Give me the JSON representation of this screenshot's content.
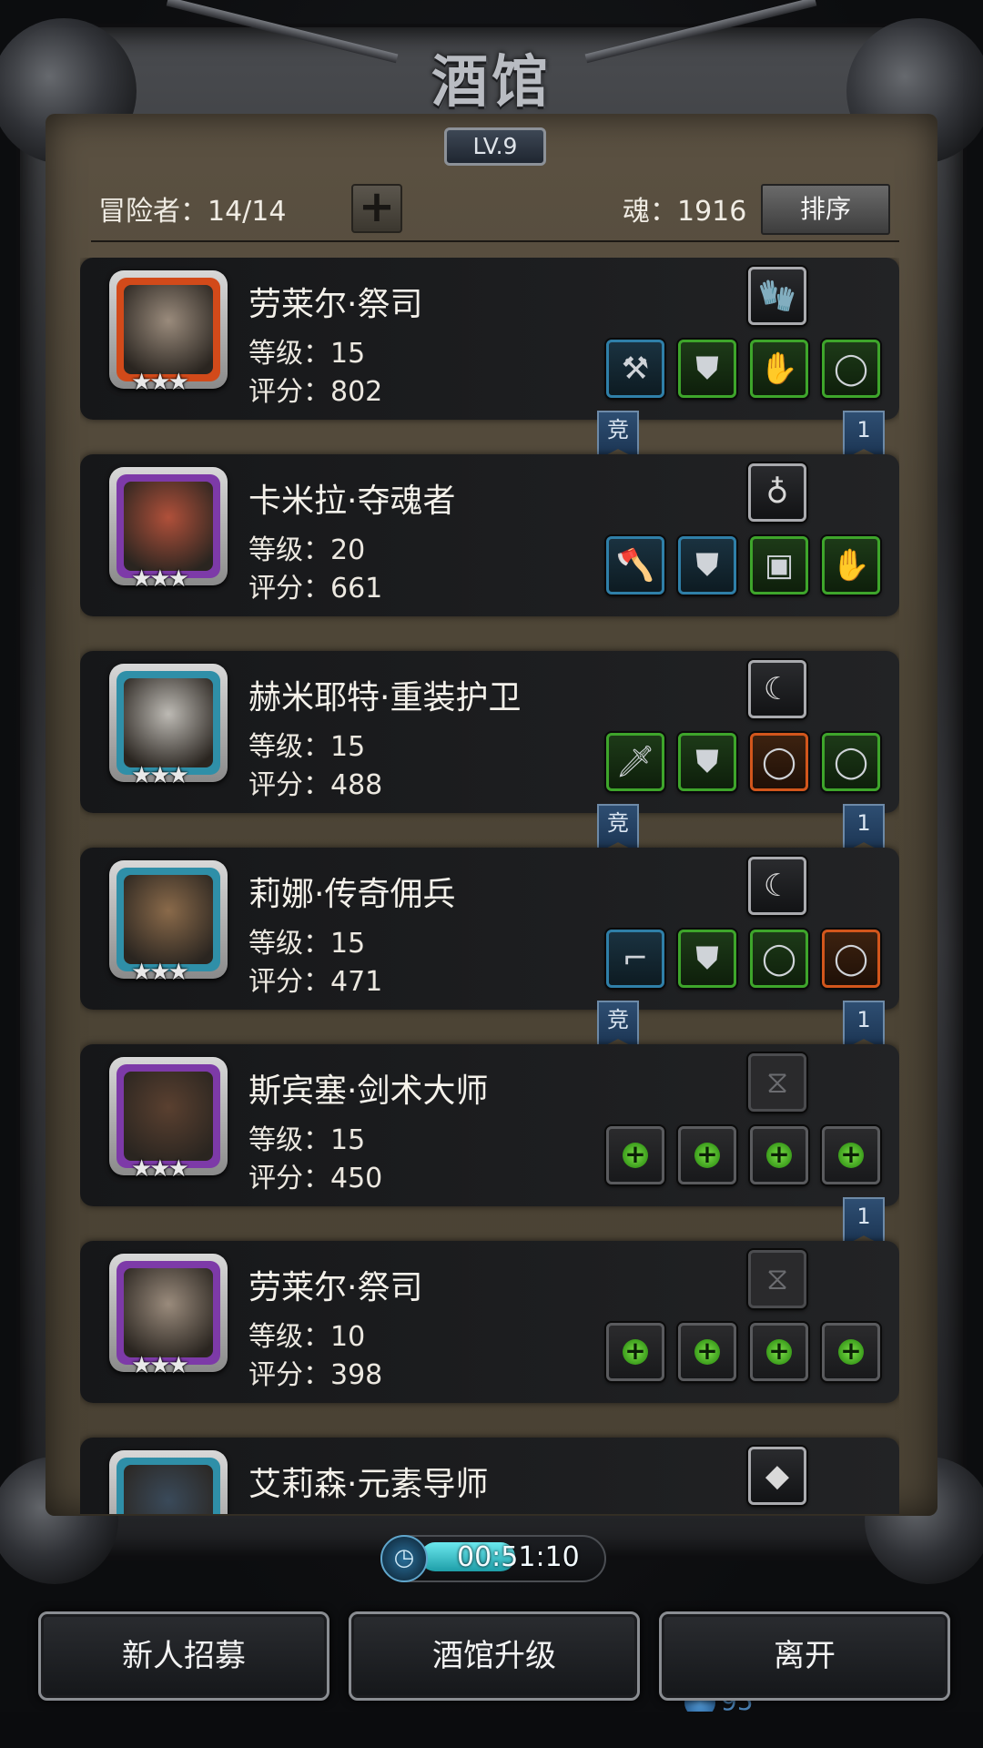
{
  "title": "酒馆",
  "level_badge": "LV.9",
  "header": {
    "adventurers": "冒险者：14/14",
    "soul": "魂：1916",
    "sort_label": "排序"
  },
  "heroes": [
    {
      "name": "劳莱尔·祭司",
      "level": "等级：15",
      "score": "评分：802",
      "stars": "★★★",
      "frame_color": "#d24a1a",
      "face_color": "#9a8b7c",
      "top_item": {
        "icon": "glove-icon",
        "rarity": "gray",
        "glyph": "🧤"
      },
      "items": [
        {
          "icon": "hammer-icon",
          "rarity": "blue",
          "glyph": "⚒"
        },
        {
          "icon": "chest-armor-icon",
          "rarity": "green",
          "glyph": "⛊"
        },
        {
          "icon": "gauntlet-icon",
          "rarity": "green",
          "glyph": "✋"
        },
        {
          "icon": "ring-icon",
          "rarity": "green",
          "glyph": "◯"
        }
      ],
      "badges": {
        "left": "竞",
        "right": "1"
      }
    },
    {
      "name": "卡米拉·夺魂者",
      "level": "等级：20",
      "score": "评分：661",
      "stars": "★★★",
      "frame_color": "#7d3aa8",
      "face_color": "#b0503a",
      "top_item": {
        "icon": "amulet-icon",
        "rarity": "gray",
        "glyph": "♁"
      },
      "items": [
        {
          "icon": "axe-icon",
          "rarity": "blue",
          "glyph": "🪓"
        },
        {
          "icon": "chest-armor-icon",
          "rarity": "blue",
          "glyph": "⛊"
        },
        {
          "icon": "treasure-chest-icon",
          "rarity": "green",
          "glyph": "▣"
        },
        {
          "icon": "gauntlet-icon",
          "rarity": "green",
          "glyph": "✋"
        }
      ],
      "badges": {
        "left": "",
        "right": ""
      }
    },
    {
      "name": "赫米耶特·重装护卫",
      "level": "等级：15",
      "score": "评分：488",
      "stars": "★★★",
      "frame_color": "#2f8fa8",
      "face_color": "#bdbab4",
      "top_item": {
        "icon": "claw-icon",
        "rarity": "gray",
        "glyph": "☾"
      },
      "items": [
        {
          "icon": "sword-icon",
          "rarity": "green",
          "glyph": "🗡"
        },
        {
          "icon": "chest-armor-icon",
          "rarity": "green",
          "glyph": "⛊"
        },
        {
          "icon": "ring-icon",
          "rarity": "orange",
          "glyph": "◯"
        },
        {
          "icon": "ring-icon",
          "rarity": "green",
          "glyph": "◯"
        }
      ],
      "badges": {
        "left": "竞",
        "right": "1"
      }
    },
    {
      "name": "莉娜·传奇佣兵",
      "level": "等级：15",
      "score": "评分：471",
      "stars": "★★★",
      "frame_color": "#2f8fa8",
      "face_color": "#8a6a4a",
      "top_item": {
        "icon": "claw-icon",
        "rarity": "gray",
        "glyph": "☾"
      },
      "items": [
        {
          "icon": "pistol-icon",
          "rarity": "blue",
          "glyph": "⌐"
        },
        {
          "icon": "chest-armor-icon",
          "rarity": "green",
          "glyph": "⛊"
        },
        {
          "icon": "ring-icon",
          "rarity": "green",
          "glyph": "◯"
        },
        {
          "icon": "ring-icon",
          "rarity": "orange",
          "glyph": "◯"
        }
      ],
      "badges": {
        "left": "竞",
        "right": "1"
      }
    },
    {
      "name": "斯宾塞·剑术大师",
      "level": "等级：15",
      "score": "评分：450",
      "stars": "★★★",
      "frame_color": "#7d3aa8",
      "face_color": "#5a4030",
      "top_item": {
        "icon": "hourglass-icon",
        "rarity": "empty",
        "glyph": "⧖"
      },
      "items": [
        {
          "icon": "add-weapon-icon",
          "rarity": "empty",
          "glyph": "+"
        },
        {
          "icon": "add-armor-icon",
          "rarity": "empty",
          "glyph": "+"
        },
        {
          "icon": "add-ring-icon",
          "rarity": "empty",
          "glyph": "+"
        },
        {
          "icon": "add-ring-icon",
          "rarity": "empty",
          "glyph": "+"
        }
      ],
      "badges": {
        "left": "",
        "right": "1"
      }
    },
    {
      "name": "劳莱尔·祭司",
      "level": "等级：10",
      "score": "评分：398",
      "stars": "★★★",
      "frame_color": "#7d3aa8",
      "face_color": "#9a8b7c",
      "top_item": {
        "icon": "hourglass-icon",
        "rarity": "empty",
        "glyph": "⧖"
      },
      "items": [
        {
          "icon": "add-weapon-icon",
          "rarity": "empty",
          "glyph": "+"
        },
        {
          "icon": "add-armor-icon",
          "rarity": "empty",
          "glyph": "+"
        },
        {
          "icon": "add-ring-icon",
          "rarity": "empty",
          "glyph": "+"
        },
        {
          "icon": "add-ring-icon",
          "rarity": "empty",
          "glyph": "+"
        }
      ],
      "badges": {
        "left": "",
        "right": ""
      }
    },
    {
      "name": "艾莉森·元素导师",
      "level": "",
      "score": "",
      "stars": "",
      "frame_color": "#2f8fa8",
      "face_color": "#3a4a5a",
      "top_item": {
        "icon": "crystal-icon",
        "rarity": "gray",
        "glyph": "◆"
      },
      "items": [],
      "badges": {
        "left": "",
        "right": ""
      }
    }
  ],
  "timer": {
    "text": "00:51:10",
    "progress": 0.53,
    "icon": "clock-icon"
  },
  "buttons": {
    "recruit": "新人招募",
    "upgrade": "酒馆升级",
    "leave": "离开"
  },
  "bottom_gem_count": "95",
  "colors": {
    "rarity_blue": "#2f7fa8",
    "rarity_green": "#3ea52b",
    "rarity_orange": "#d2561c",
    "timer_fill": "#3cc8d0"
  }
}
